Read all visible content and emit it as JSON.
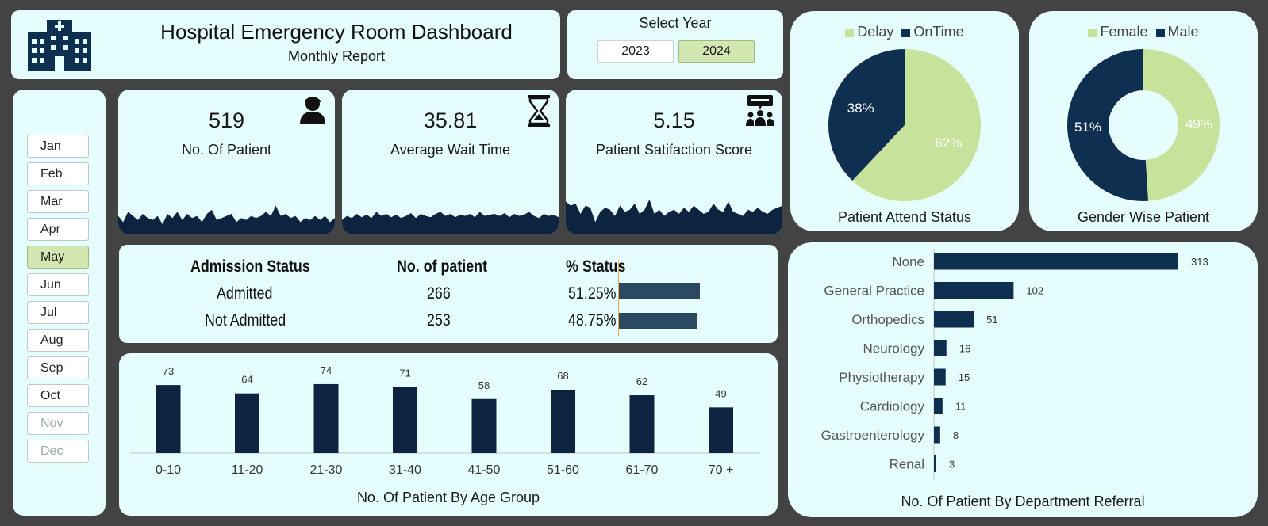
{
  "header": {
    "title": "Hospital Emergency Room Dashboard",
    "subtitle": "Monthly Report",
    "icon": "hospital-icon"
  },
  "year_filter": {
    "title": "Select Year",
    "options": [
      "2023",
      "2024"
    ],
    "selected": "2024"
  },
  "month_filter": {
    "months": [
      "Jan",
      "Feb",
      "Mar",
      "Apr",
      "May",
      "Jun",
      "Jul",
      "Aug",
      "Sep",
      "Oct",
      "Nov",
      "Dec"
    ],
    "selected": "May",
    "unavailable": [
      "Nov",
      "Dec"
    ]
  },
  "kpis": [
    {
      "value": "519",
      "label": "No. Of Patient",
      "icon": "patient-icon",
      "trend": [
        0.45,
        0.3,
        0.55,
        0.45,
        0.35,
        0.5,
        0.4,
        0.35,
        0.45,
        0.25,
        0.5,
        0.4,
        0.55,
        0.35,
        0.5,
        0.4,
        0.45,
        0.3,
        0.5,
        0.6,
        0.35,
        0.4,
        0.45,
        0.5,
        0.3,
        0.4,
        0.35,
        0.45,
        0.4,
        0.45,
        0.55,
        0.45,
        0.7,
        0.45,
        0.5,
        0.4,
        0.45,
        0.3,
        0.4,
        0.35,
        0.45,
        0.35,
        0.45,
        0.3,
        0.4
      ]
    },
    {
      "value": "35.81",
      "label": "Average Wait Time",
      "icon": "hourglass-icon",
      "trend": [
        0.35,
        0.45,
        0.4,
        0.5,
        0.42,
        0.48,
        0.4,
        0.55,
        0.45,
        0.5,
        0.42,
        0.48,
        0.4,
        0.45,
        0.52,
        0.4,
        0.5,
        0.45,
        0.42,
        0.5,
        0.55,
        0.45,
        0.5,
        0.42,
        0.48,
        0.45,
        0.5,
        0.42,
        0.55,
        0.45,
        0.48,
        0.5,
        0.45,
        0.52,
        0.42,
        0.5,
        0.45,
        0.48,
        0.55,
        0.45,
        0.4,
        0.5,
        0.45,
        0.48,
        0.42
      ]
    },
    {
      "value": "5.15",
      "label": "Patient Satifaction Score",
      "icon": "meeting-icon",
      "trend": [
        0.8,
        0.7,
        0.75,
        0.5,
        0.7,
        0.65,
        0.3,
        0.55,
        0.65,
        0.6,
        0.45,
        0.7,
        0.55,
        0.6,
        0.75,
        0.5,
        0.6,
        0.85,
        0.5,
        0.6,
        0.45,
        0.55,
        0.6,
        0.5,
        0.65,
        0.55,
        0.7,
        0.6,
        0.5,
        0.55,
        0.75,
        0.6,
        0.55,
        0.8,
        0.55,
        0.5,
        0.45,
        0.6,
        0.55,
        0.65,
        0.55,
        0.5,
        0.6,
        0.65,
        0.7
      ]
    }
  ],
  "admission": {
    "headers": [
      "Admission Status",
      "No. of patient",
      "% Status"
    ],
    "rows": [
      {
        "status": "Admitted",
        "count": "266",
        "pct": "51.25%",
        "share": 0.5125
      },
      {
        "status": "Not Admitted",
        "count": "253",
        "pct": "48.75%",
        "share": 0.4875
      }
    ]
  },
  "chart_data": [
    {
      "type": "pie",
      "title": "Patient Attend Status",
      "categories": [
        "Delay",
        "OnTime"
      ],
      "values": [
        62,
        38
      ],
      "value_labels": [
        "62%",
        "38%"
      ],
      "colors": [
        "#c7e29a",
        "#0f2f50"
      ],
      "legend": "top"
    },
    {
      "type": "pie",
      "title": "Gender Wise Patient",
      "categories": [
        "Female",
        "Male"
      ],
      "values": [
        49,
        51
      ],
      "value_labels": [
        "49%",
        "51%"
      ],
      "colors": [
        "#c7e29a",
        "#0f2f50"
      ],
      "legend": "top"
    },
    {
      "type": "bar",
      "title": "No. Of Patient By Age Group",
      "categories": [
        "0-10",
        "11-20",
        "21-30",
        "31-40",
        "41-50",
        "51-60",
        "61-70",
        "70 +"
      ],
      "values": [
        73,
        64,
        74,
        71,
        58,
        68,
        62,
        49
      ],
      "color": "#0c2440",
      "ylim": [
        0,
        85
      ]
    },
    {
      "type": "bar",
      "orientation": "horizontal",
      "title": "No. Of Patient By Department Referral",
      "categories": [
        "None",
        "General Practice",
        "Orthopedics",
        "Neurology",
        "Physiotherapy",
        "Cardiology",
        "Gastroenterology",
        "Renal"
      ],
      "values": [
        313,
        102,
        51,
        16,
        15,
        11,
        8,
        3
      ],
      "color": "#0f2f50",
      "xlim": [
        0,
        313
      ]
    }
  ]
}
